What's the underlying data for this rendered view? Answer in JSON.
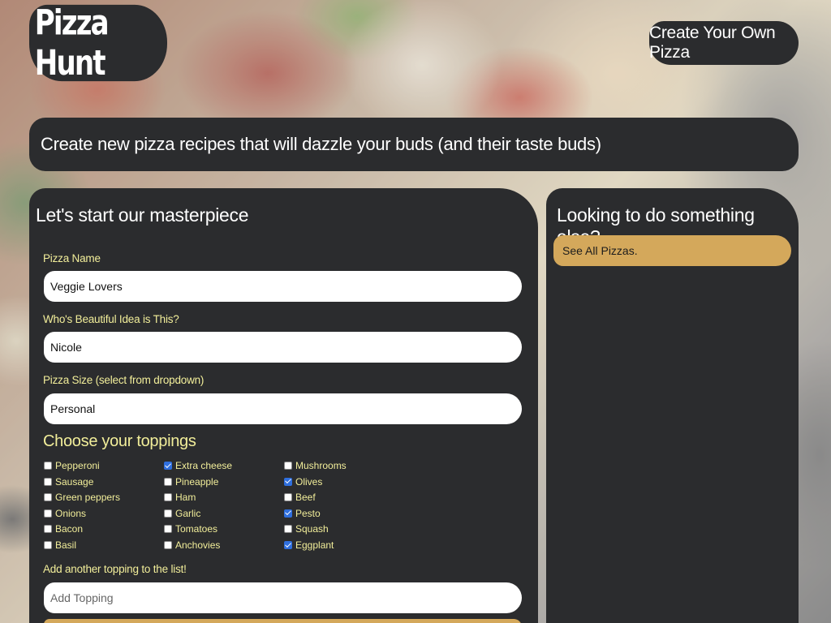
{
  "header": {
    "logo_text": "Pizza Hunt",
    "create_button_label": "Create Your Own Pizza"
  },
  "tagline": "Create new pizza recipes that will dazzle your buds (and their taste buds)",
  "form": {
    "title": "Let's start our masterpiece",
    "pizza_name_label": "Pizza Name",
    "pizza_name_value": "Veggie Lovers",
    "created_by_label": "Who's Beautiful Idea is This?",
    "created_by_value": "Nicole",
    "size_label": "Pizza Size (select from dropdown)",
    "size_value": "Personal",
    "toppings_title": "Choose your toppings",
    "toppings": [
      {
        "label": "Pepperoni",
        "checked": false
      },
      {
        "label": "Sausage",
        "checked": false
      },
      {
        "label": "Green peppers",
        "checked": false
      },
      {
        "label": "Onions",
        "checked": false
      },
      {
        "label": "Bacon",
        "checked": false
      },
      {
        "label": "Basil",
        "checked": false
      },
      {
        "label": "Extra cheese",
        "checked": true
      },
      {
        "label": "Pineapple",
        "checked": false
      },
      {
        "label": "Ham",
        "checked": false
      },
      {
        "label": "Garlic",
        "checked": false
      },
      {
        "label": "Tomatoes",
        "checked": false
      },
      {
        "label": "Anchovies",
        "checked": false
      },
      {
        "label": "Mushrooms",
        "checked": false
      },
      {
        "label": "Olives",
        "checked": true
      },
      {
        "label": "Beef",
        "checked": false
      },
      {
        "label": "Pesto",
        "checked": true
      },
      {
        "label": "Squash",
        "checked": false
      },
      {
        "label": "Eggplant",
        "checked": true
      }
    ],
    "add_topping_label": "Add another topping to the list!",
    "add_topping_placeholder": "Add Topping"
  },
  "sidebar": {
    "title": "Looking to do something else?",
    "see_all_label": "See All Pizzas."
  },
  "colors": {
    "panel": "#2b2c2e",
    "label_yellow": "#f2ee9a",
    "accent_gold": "#d4a85b",
    "checkbox_checked": "#2f6fde"
  }
}
